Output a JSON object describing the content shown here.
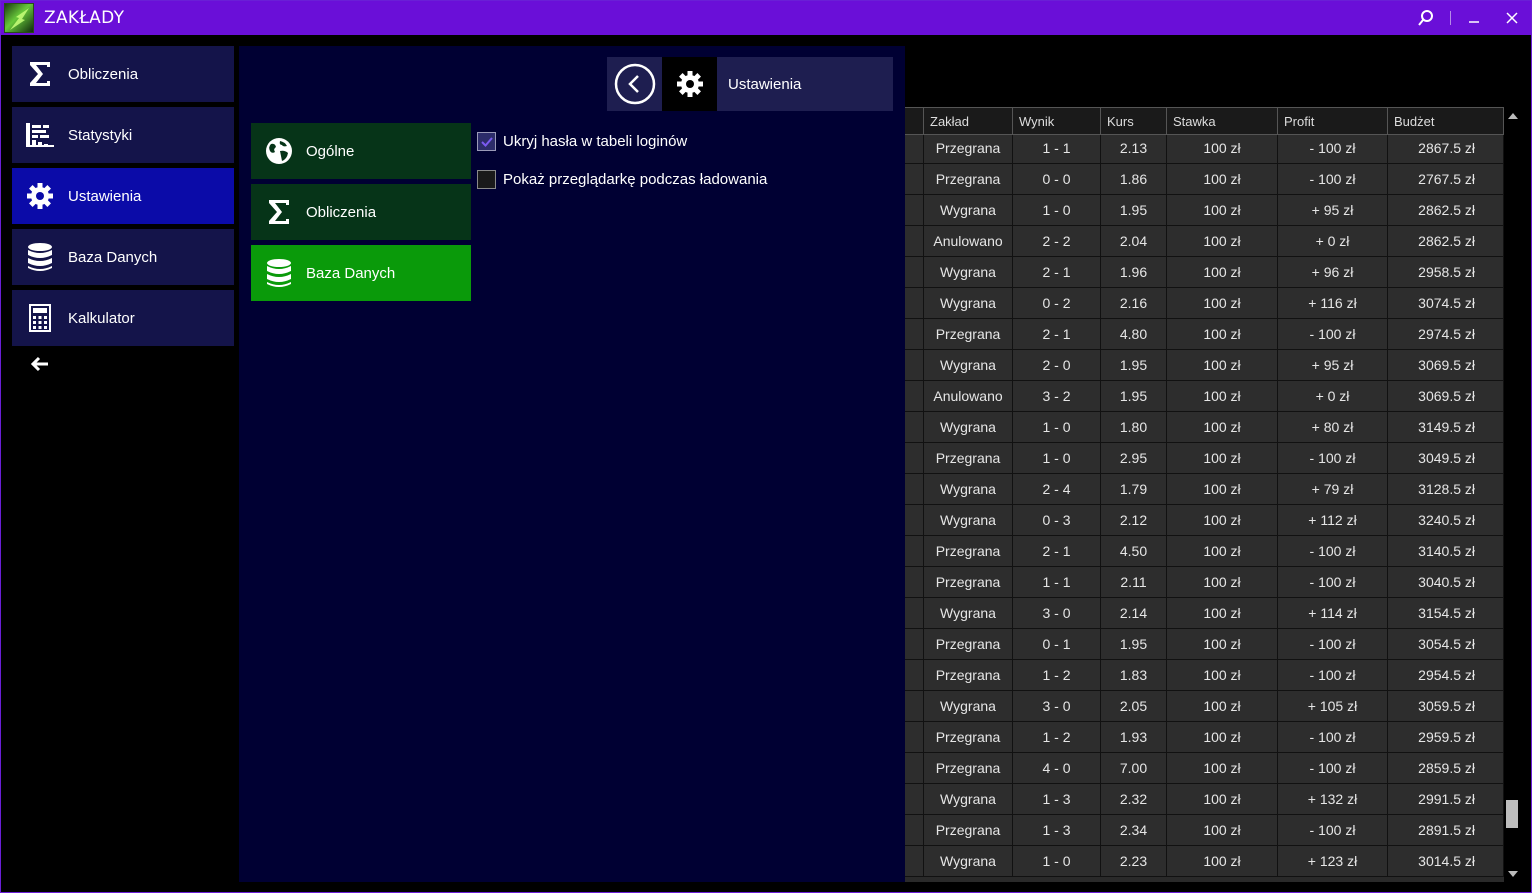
{
  "window": {
    "title": "ZAKŁADY"
  },
  "colors": {
    "titlebar": "#6a0fd8",
    "nav_active": "#0b0ba8",
    "nav": "#14144a",
    "sub_active": "#0a9a0a",
    "sub": "#063418",
    "panel": "#000033"
  },
  "leftnav": {
    "items": [
      {
        "label": "Obliczenia",
        "icon": "sigma-icon"
      },
      {
        "label": "Statystyki",
        "icon": "stats-icon"
      },
      {
        "label": "Ustawienia",
        "icon": "gear-icon",
        "active": true
      },
      {
        "label": "Baza Danych",
        "icon": "database-icon"
      },
      {
        "label": "Kalkulator",
        "icon": "calculator-icon"
      }
    ]
  },
  "settings": {
    "header_title": "Ustawienia",
    "subnav": [
      {
        "label": "Ogólne",
        "icon": "globe-icon"
      },
      {
        "label": "Obliczenia",
        "icon": "sigma-icon"
      },
      {
        "label": "Baza Danych",
        "icon": "database-icon",
        "active": true
      }
    ],
    "options": [
      {
        "label": "Ukryj hasła w tabeli loginów",
        "checked": true
      },
      {
        "label": "Pokaż przeglądarkę podczas ładowania",
        "checked": false
      }
    ]
  },
  "table": {
    "columns": [
      "Zakład",
      "Wynik",
      "Kurs",
      "Stawka",
      "Profit",
      "Budżet"
    ],
    "rows": [
      [
        "Przegrana",
        "1 - 1",
        "2.13",
        "100 zł",
        "- 100 zł",
        "2867.5 zł"
      ],
      [
        "Przegrana",
        "0 - 0",
        "1.86",
        "100 zł",
        "- 100 zł",
        "2767.5 zł"
      ],
      [
        "Wygrana",
        "1 - 0",
        "1.95",
        "100 zł",
        "+ 95 zł",
        "2862.5 zł"
      ],
      [
        "Anulowano",
        "2 - 2",
        "2.04",
        "100 zł",
        "+ 0 zł",
        "2862.5 zł"
      ],
      [
        "Wygrana",
        "2 - 1",
        "1.96",
        "100 zł",
        "+ 96 zł",
        "2958.5 zł"
      ],
      [
        "Wygrana",
        "0 - 2",
        "2.16",
        "100 zł",
        "+ 116 zł",
        "3074.5 zł"
      ],
      [
        "Przegrana",
        "2 - 1",
        "4.80",
        "100 zł",
        "- 100 zł",
        "2974.5 zł"
      ],
      [
        "Wygrana",
        "2 - 0",
        "1.95",
        "100 zł",
        "+ 95 zł",
        "3069.5 zł"
      ],
      [
        "Anulowano",
        "3 - 2",
        "1.95",
        "100 zł",
        "+ 0 zł",
        "3069.5 zł"
      ],
      [
        "Wygrana",
        "1 - 0",
        "1.80",
        "100 zł",
        "+ 80 zł",
        "3149.5 zł"
      ],
      [
        "Przegrana",
        "1 - 0",
        "2.95",
        "100 zł",
        "- 100 zł",
        "3049.5 zł"
      ],
      [
        "Wygrana",
        "2 - 4",
        "1.79",
        "100 zł",
        "+ 79 zł",
        "3128.5 zł"
      ],
      [
        "Wygrana",
        "0 - 3",
        "2.12",
        "100 zł",
        "+ 112 zł",
        "3240.5 zł"
      ],
      [
        "Przegrana",
        "2 - 1",
        "4.50",
        "100 zł",
        "- 100 zł",
        "3140.5 zł"
      ],
      [
        "Przegrana",
        "1 - 1",
        "2.11",
        "100 zł",
        "- 100 zł",
        "3040.5 zł"
      ],
      [
        "Wygrana",
        "3 - 0",
        "2.14",
        "100 zł",
        "+ 114 zł",
        "3154.5 zł"
      ],
      [
        "Przegrana",
        "0 - 1",
        "1.95",
        "100 zł",
        "- 100 zł",
        "3054.5 zł"
      ],
      [
        "Przegrana",
        "1 - 2",
        "1.83",
        "100 zł",
        "- 100 zł",
        "2954.5 zł"
      ],
      [
        "Wygrana",
        "3 - 0",
        "2.05",
        "100 zł",
        "+ 105 zł",
        "3059.5 zł"
      ],
      [
        "Przegrana",
        "1 - 2",
        "1.93",
        "100 zł",
        "- 100 zł",
        "2959.5 zł"
      ],
      [
        "Przegrana",
        "4 - 0",
        "7.00",
        "100 zł",
        "- 100 zł",
        "2859.5 zł"
      ],
      [
        "Wygrana",
        "1 - 3",
        "2.32",
        "100 zł",
        "+ 132 zł",
        "2991.5 zł"
      ],
      [
        "Przegrana",
        "1 - 3",
        "2.34",
        "100 zł",
        "- 100 zł",
        "2891.5 zł"
      ],
      [
        "Wygrana",
        "1 - 0",
        "2.23",
        "100 zł",
        "+ 123 zł",
        "3014.5 zł"
      ]
    ]
  }
}
